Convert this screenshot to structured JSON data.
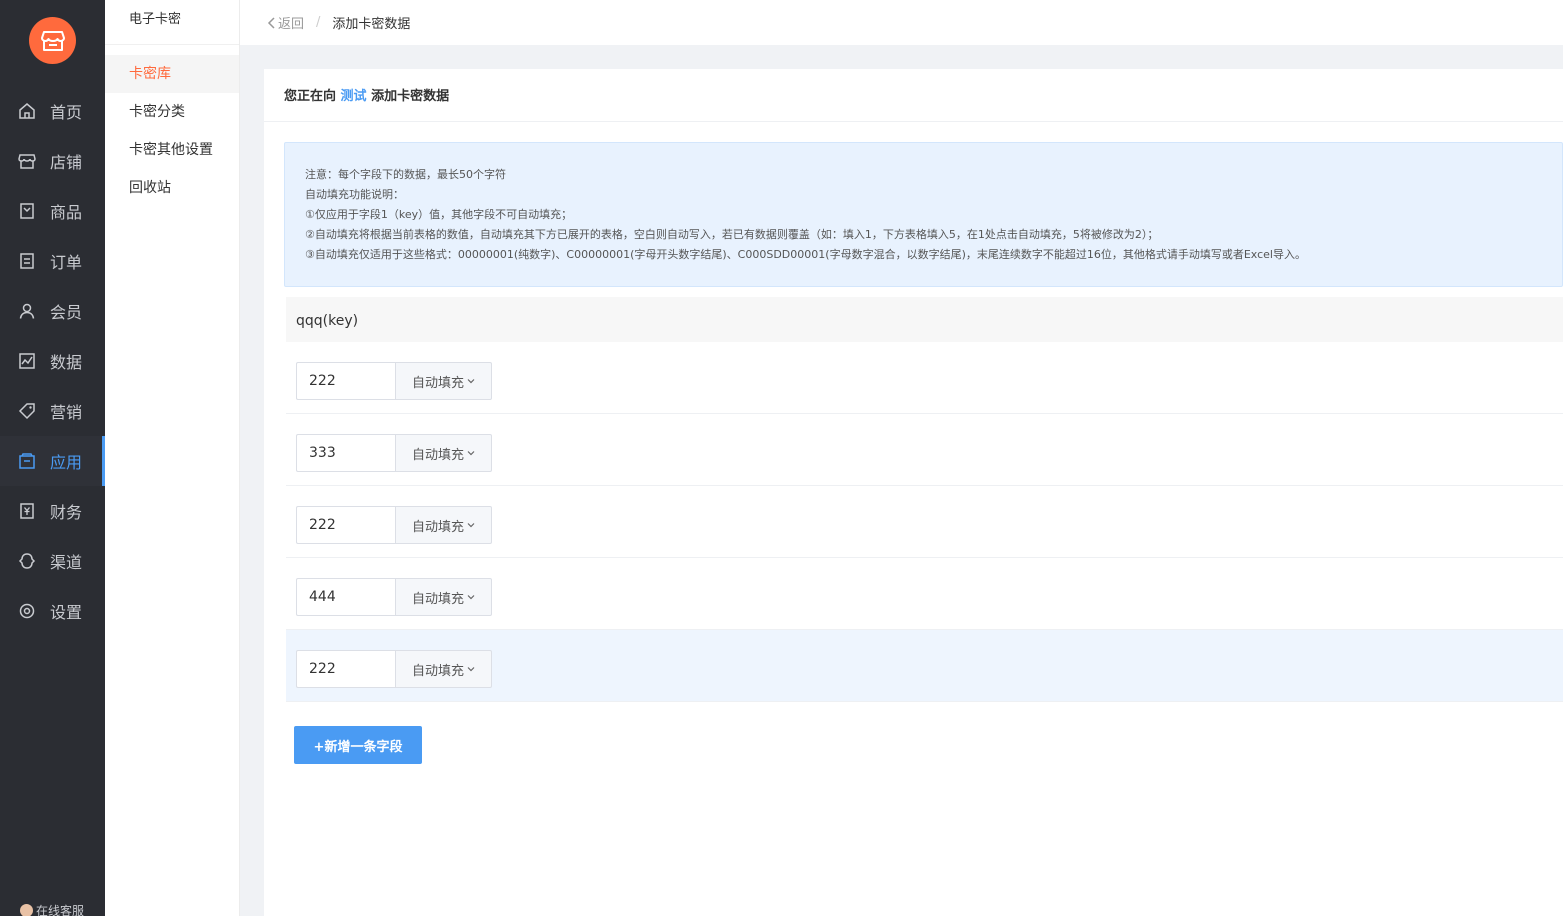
{
  "nav": {
    "items": [
      {
        "label": "首页",
        "icon": "home-icon"
      },
      {
        "label": "店铺",
        "icon": "store-icon"
      },
      {
        "label": "商品",
        "icon": "goods-icon"
      },
      {
        "label": "订单",
        "icon": "order-icon"
      },
      {
        "label": "会员",
        "icon": "user-icon"
      },
      {
        "label": "数据",
        "icon": "chart-icon"
      },
      {
        "label": "营销",
        "icon": "tag-icon"
      },
      {
        "label": "应用",
        "icon": "app-icon"
      },
      {
        "label": "财务",
        "icon": "finance-icon"
      },
      {
        "label": "渠道",
        "icon": "channel-icon"
      },
      {
        "label": "设置",
        "icon": "gear-icon"
      }
    ],
    "active_index": 7,
    "service_label": "在线客服"
  },
  "sub": {
    "title": "电子卡密",
    "items": [
      "卡密库",
      "卡密分类",
      "卡密其他设置",
      "回收站"
    ],
    "active_index": 0
  },
  "breadcrumb": {
    "back_label": "返回",
    "separator": "/",
    "current": "添加卡密数据"
  },
  "card": {
    "title_prefix": "您正在向",
    "title_target": "测试",
    "title_suffix": "添加卡密数据"
  },
  "notice": {
    "lines": [
      "注意：每个字段下的数据，最长50个字符",
      "自动填充功能说明：",
      "①仅应用于字段1（key）值，其他字段不可自动填充；",
      "②自动填充将根据当前表格的数值，自动填充其下方已展开的表格，空白则自动写入，若已有数据则覆盖（如：填入1，下方表格填入5，在1处点击自动填充，5将被修改为2）；",
      "③自动填充仅适用于这些格式：00000001(纯数字)、C00000001(字母开头数字结尾)、C000SDD00001(字母数字混合，以数字结尾)，末尾连续数字不能超过16位，其他格式请手动填写或者Excel导入。"
    ]
  },
  "field": {
    "header": "qqq(key)",
    "autofill_label": "自动填充",
    "rows": [
      {
        "value": "222"
      },
      {
        "value": "333"
      },
      {
        "value": "222"
      },
      {
        "value": "444"
      },
      {
        "value": "222"
      }
    ],
    "highlighted_index": 4
  },
  "add_button_label": "+新增一条字段",
  "colors": {
    "accent": "#4a9bf3",
    "brand": "#ff6a3d",
    "sidebar_bg": "#2b2d33"
  }
}
